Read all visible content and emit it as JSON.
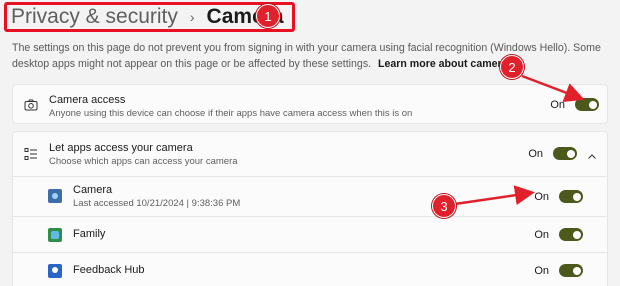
{
  "header": {
    "breadcrumb_parent": "Privacy & security",
    "breadcrumb_separator": "›",
    "breadcrumb_current": "Camera"
  },
  "annotations": [
    "1",
    "2",
    "3"
  ],
  "description": {
    "text": "The settings on this page do not prevent you from signing in with your camera using facial recognition (Windows Hello). Some desktop apps might not appear on this page or be affected by these settings.",
    "link_label": "Learn more about camera"
  },
  "camera_access": {
    "title": "Camera access",
    "subtitle": "Anyone using this device can choose if their apps have camera access when this is on",
    "state_label": "On",
    "state": true
  },
  "apps_access": {
    "title": "Let apps access your camera",
    "subtitle": "Choose which apps can access your camera",
    "state_label": "On",
    "state": true,
    "expanded": true
  },
  "apps": [
    {
      "name": "Camera",
      "detail": "Last accessed 10/21/2024  |  9:38:36 PM",
      "state_label": "On",
      "state": true
    },
    {
      "name": "Family",
      "detail": "",
      "state_label": "On",
      "state": true
    },
    {
      "name": "Feedback Hub",
      "detail": "",
      "state_label": "On",
      "state": true
    }
  ],
  "colors": {
    "toggle_on": "#4b5a1c",
    "annotation_red": "#e0202a"
  }
}
